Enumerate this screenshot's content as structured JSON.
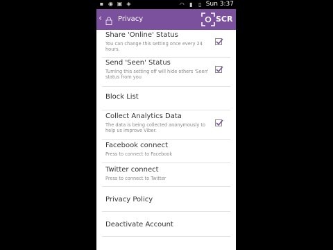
{
  "status_bar": {
    "time": "Sun 3:37"
  },
  "app_bar": {
    "title": "Privacy",
    "badge": "SCR",
    "accent": "#7b519d"
  },
  "settings": [
    {
      "title": "Share 'Online' Status",
      "subtitle": "You can change this setting once every 24 hours.",
      "checked": true
    },
    {
      "title": "Send 'Seen' Status",
      "subtitle": "Turning this setting off will hide others 'Seen' status from you",
      "checked": true
    },
    {
      "title": "Block List",
      "subtitle": ""
    },
    {
      "title": "Collect Analytics Data",
      "subtitle": "The data is being collected anonymously to help us improve Viber.",
      "checked": true
    },
    {
      "title": "Facebook connect",
      "subtitle": "Press to connect to Facebook"
    },
    {
      "title": "Twitter connect",
      "subtitle": "Press to connect to Twitter"
    },
    {
      "title": "Privacy Policy",
      "subtitle": ""
    },
    {
      "title": "Deactivate Account",
      "subtitle": ""
    }
  ]
}
